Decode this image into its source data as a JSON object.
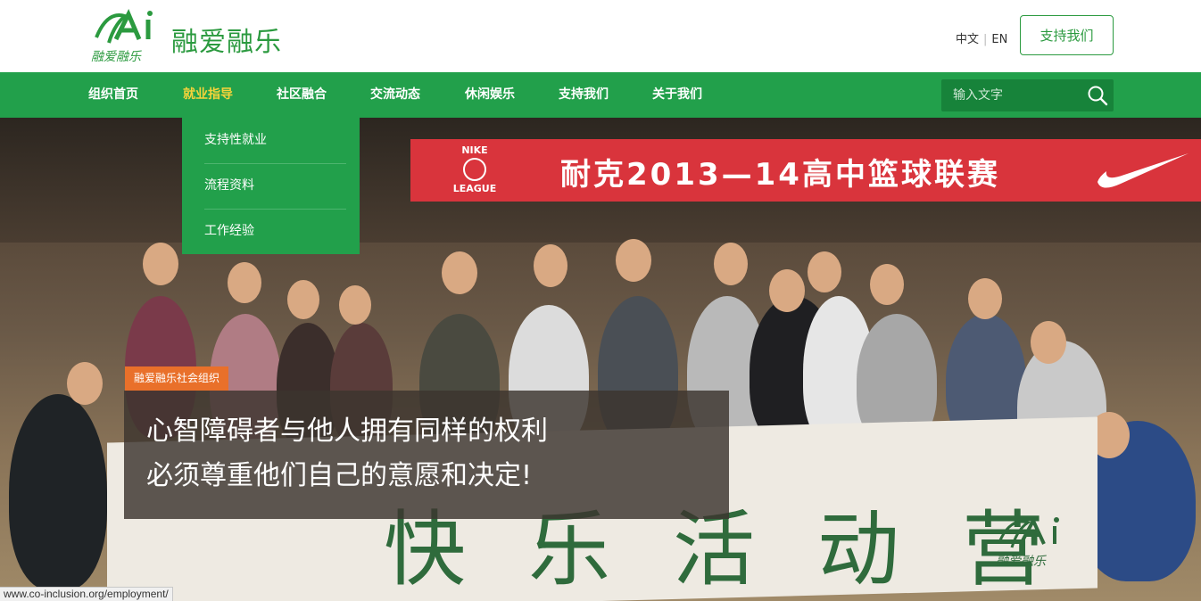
{
  "header": {
    "logo_alt_text": "Ai",
    "site_name": "融爱融乐",
    "lang_zh": "中文",
    "lang_separator": "|",
    "lang_en": "EN",
    "support_button": "支持我们",
    "brand_color": "#22a04b"
  },
  "nav": {
    "items": [
      {
        "label": "组织首页"
      },
      {
        "label": "就业指导",
        "active": true
      },
      {
        "label": "社区融合"
      },
      {
        "label": "交流动态"
      },
      {
        "label": "休闲娱乐"
      },
      {
        "label": "支持我们"
      },
      {
        "label": "关于我们"
      }
    ],
    "search_placeholder": "输入文字",
    "active_color": "#f5d33a"
  },
  "dropdown": {
    "items": [
      {
        "label": "支持性就业"
      },
      {
        "label": "流程资料"
      },
      {
        "label": "工作经验"
      }
    ]
  },
  "hero": {
    "banner_text": "耐克2013—14高中篮球联赛",
    "banner_logo_top": "NIKE",
    "banner_logo_bottom": "LEAGUE",
    "cloth_text": "快乐活动营",
    "tag": "融爱融乐社会组织",
    "caption_line1": "心智障碍者与他人拥有同样的权利",
    "caption_line2": "必须尊重他们自己的意愿和决定!",
    "tag_color": "#e9702a"
  },
  "statusbar": {
    "url": "www.co-inclusion.org/employment/"
  }
}
